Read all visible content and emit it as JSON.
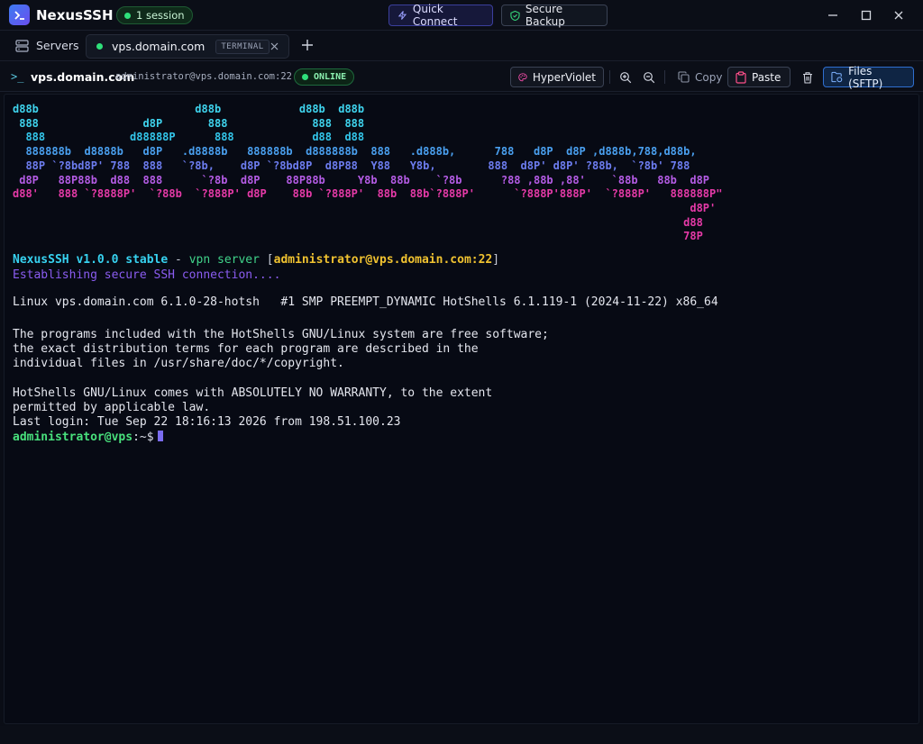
{
  "app": {
    "title": "NexusSSH",
    "session_count": "1 session"
  },
  "titlebar": {
    "quick_connect": "Quick Connect",
    "secure_backup": "Secure Backup"
  },
  "tabs": {
    "servers": "Servers",
    "active": {
      "name": "vps.domain.com",
      "badge": "TERMINAL"
    }
  },
  "session": {
    "host": "vps.domain.com",
    "connection": "administrator@vps.domain.com:22",
    "status": "ONLINE",
    "theme": "HyperViolet",
    "copy": "Copy",
    "paste": "Paste",
    "files": "Files (SFTP)"
  },
  "terminal": {
    "ascii_art": [
      {
        "text": "d88b                        d88b            d88b  d88b",
        "color": "#3fd4ee"
      },
      {
        "text": " 888                d8P       888             888  888",
        "color": "#3fd4ee"
      },
      {
        "text": "  888             d88888P      888            d88  d88",
        "color": "#33c6ea"
      },
      {
        "text": "  888888b  d8888b   d8P   .d8888b   888888b  d888888b  888   .d888b,      788   d8P  d8P ,d888b,788,d88b,",
        "color": "#4aa0f0"
      },
      {
        "text": "  88P `?8bd8P' 788  888   `?8b,    d8P `?8bd8P  d8P88  Y88   Y8b,        888  d8P' d8P' ?88b,  `?8b' 788",
        "color": "#6d7df0"
      },
      {
        "text": " d8P   88P88b  d88  888      `?8b  d8P    88P88b     Y8b  88b    `?8b      ?88 ,88b ,88'    `88b   88b  d8P",
        "color": "#b55ce6"
      },
      {
        "text": "d88'   888 `?8888P'  `?88b  `?888P' d8P    88b `?888P'  88b  88b`?888P'      `?888P'888P'  `?888P'   888888P\"",
        "color": "#e63aa8"
      },
      {
        "text": "                                                                                                        d8P'",
        "color": "#e63aa8"
      },
      {
        "text": "                                                                                                       d88",
        "color": "#e63aa8"
      },
      {
        "text": "                                                                                                       78P",
        "color": "#e63aa8"
      }
    ],
    "banner": {
      "brand": "NexusSSH",
      "version": "v1.0.0 stable",
      "dash": "-",
      "vpn": "vpn server",
      "user_host": "administrator@vps.domain.com:22"
    },
    "establishing": "Establishing secure SSH connection....",
    "uname": "Linux vps.domain.com 6.1.0-28-hotsh   #1 SMP PREEMPT_DYNAMIC HotShells 6.1.119-1 (2024-11-22) x86_64",
    "motd": [
      "The programs included with the HotShells GNU/Linux system are free software;",
      "the exact distribution terms for each program are described in the",
      "individual files in /usr/share/doc/*/copyright."
    ],
    "warranty": [
      "HotShells GNU/Linux comes with ABSOLUTELY NO WARRANTY, to the extent",
      "permitted by applicable law."
    ],
    "last_login": "Last login: Tue Sep 22 18:16:13 2026 from 198.51.100.23",
    "prompt": {
      "user": "administrator@vps",
      "path": ":~$"
    }
  }
}
